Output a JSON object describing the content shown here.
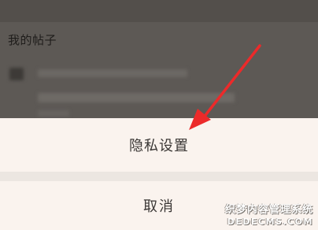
{
  "background": {
    "section_title": "我的帖子"
  },
  "action_sheet": {
    "privacy_settings_label": "隐私设置",
    "cancel_label": "取消"
  },
  "watermark": {
    "line1": "织梦内容管理系统",
    "line2": "DEDECMS.COM"
  },
  "colors": {
    "annotation_arrow": "#ec2a2a",
    "sheet_background": "#faf3ee",
    "overlay": "#5d5955"
  }
}
